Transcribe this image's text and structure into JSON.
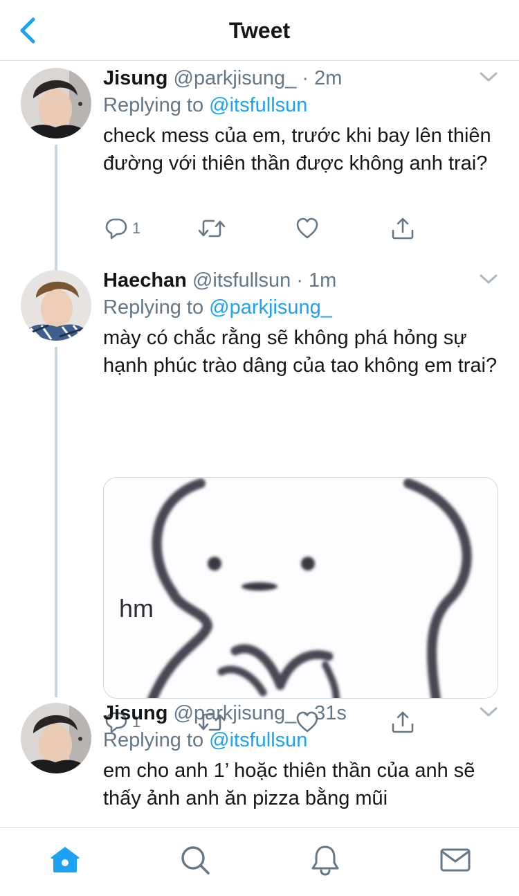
{
  "header": {
    "title": "Tweet"
  },
  "icons": {
    "back": "chevron-left-icon",
    "caret": "chevron-down-icon",
    "reply": "reply-bubble-icon",
    "retweet": "retweet-icon",
    "like": "heart-icon",
    "share": "share-icon",
    "home": "home-icon",
    "search": "search-icon",
    "notifications": "bell-icon",
    "messages": "envelope-icon"
  },
  "colors": {
    "accent": "#1da1f2",
    "muted": "#657786",
    "text": "#14171a",
    "line": "#ccd6dd"
  },
  "tweets": [
    {
      "name": "Jisung",
      "handle": "@parkjisung_",
      "separator": "·",
      "time": "2m",
      "replying_prefix": "Replying to",
      "replying_to": "@itsfullsun",
      "text": "check mess của em, trước khi bay lên thiên đường với thiên thần được không anh trai?",
      "reply_count": "1"
    },
    {
      "name": "Haechan",
      "handle": "@itsfullsun",
      "separator": "·",
      "time": "1m",
      "replying_prefix": "Replying to",
      "replying_to": "@parkjisung_",
      "text": "mày có chắc rằng sẽ không phá hỏng sự hạnh phúc trào dâng của tao không em trai?",
      "media_text": "hm",
      "reply_count": "1"
    },
    {
      "name": "Jisung",
      "handle": "@parkjisung_",
      "separator": "·",
      "time": "31s",
      "replying_prefix": "Replying to",
      "replying_to": "@itsfullsun",
      "text": "em cho anh 1’ hoặc thiên thần của anh sẽ thấy ảnh anh ăn pizza bằng mũi"
    }
  ],
  "tabbar": {
    "active": "home"
  }
}
